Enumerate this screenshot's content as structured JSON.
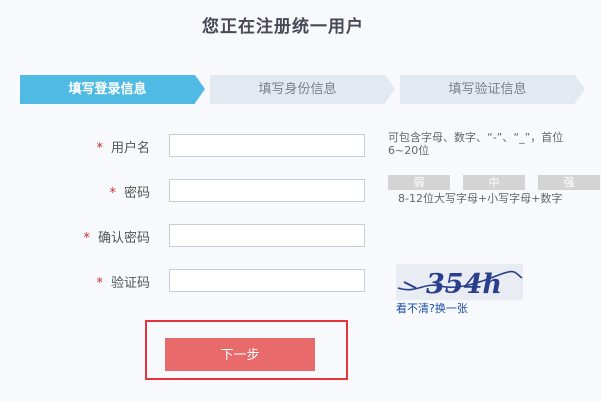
{
  "header": {
    "title": "您正在注册统一用户"
  },
  "steps": [
    {
      "label": "填写登录信息",
      "active": true
    },
    {
      "label": "填写身份信息",
      "active": false
    },
    {
      "label": "填写验证信息",
      "active": false
    }
  ],
  "form": {
    "required_mark": "*",
    "username": {
      "label": "用户名",
      "value": "",
      "hint": "可包含字母、数字、“-”、“_”，首位",
      "hint2": "6~20位"
    },
    "password": {
      "label": "密码",
      "value": "",
      "strength": [
        "弱",
        "中",
        "强"
      ],
      "hint": "8-12位大写字母+小写字母+数字"
    },
    "confirm": {
      "label": "确认密码",
      "value": ""
    },
    "captcha": {
      "label": "验证码",
      "value": "",
      "image_text": "354h",
      "refresh_link": "看不清?换一张"
    }
  },
  "actions": {
    "next_label": "下一步",
    "highlight_color": "#e3353b",
    "button_color": "#e86a6a"
  },
  "colors": {
    "step_active": "#4fbbe4",
    "step_inactive": "#e2e9f0"
  }
}
